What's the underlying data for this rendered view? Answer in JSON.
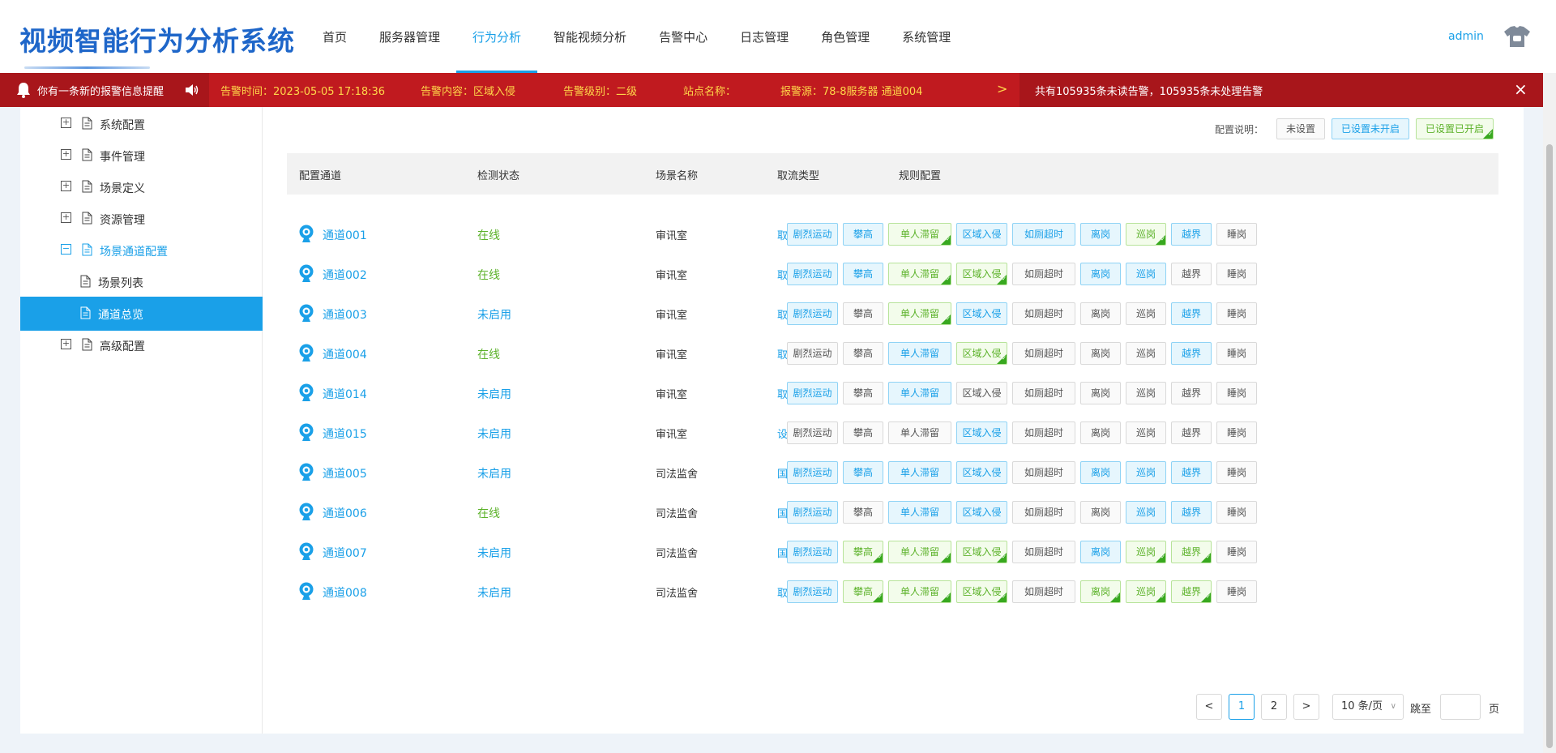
{
  "app": {
    "title": "视频智能行为分析系统"
  },
  "nav": {
    "items": [
      "首页",
      "服务器管理",
      "行为分析",
      "智能视频分析",
      "告警中心",
      "日志管理",
      "角色管理",
      "系统管理"
    ],
    "active_index": 2
  },
  "user": {
    "name": "admin"
  },
  "alarm": {
    "notice": "你有一条新的报警信息提醒",
    "time": "告警时间：2023-05-05 17:18:36",
    "content": "告警内容：区域入侵",
    "level": "告警级别：二级",
    "site": "站点名称：",
    "source": "报警源：78-8服务器 通道004",
    "summary": "共有105935条未读告警，105935条未处理告警",
    "next": ">",
    "close": "×"
  },
  "sidebar": {
    "items": [
      {
        "label": "系统配置",
        "toggle": "+"
      },
      {
        "label": "事件管理",
        "toggle": "+"
      },
      {
        "label": "场景定义",
        "toggle": "+"
      },
      {
        "label": "资源管理",
        "toggle": "+"
      },
      {
        "label": "场景通道配置",
        "toggle": "−"
      },
      {
        "label": "场景列表"
      },
      {
        "label": "通道总览"
      },
      {
        "label": "高级配置",
        "toggle": "+"
      }
    ]
  },
  "legend": {
    "title": "配置说明：",
    "not_set": "未设置",
    "set_off": "已设置未开启",
    "set_on": "已设置已开启"
  },
  "table": {
    "headers": [
      "配置通道",
      "检测状态",
      "场景名称",
      "取流类型",
      "规则配置"
    ],
    "rule_names": [
      "剧烈运动",
      "攀高",
      "单人滞留",
      "区域入侵",
      "如厕超时",
      "离岗",
      "巡岗",
      "越界",
      "睡岗"
    ],
    "rows": [
      {
        "channel": "通道001",
        "status": "在线",
        "scene": "审讯室",
        "stream": "取流配置",
        "rules": [
          "b",
          "b",
          "g",
          "b",
          "b",
          "b",
          "g",
          "b",
          "n"
        ]
      },
      {
        "channel": "通道002",
        "status": "在线",
        "scene": "审讯室",
        "stream": "取流配置",
        "rules": [
          "b",
          "b",
          "g",
          "g",
          "n",
          "b",
          "b",
          "n",
          "n"
        ]
      },
      {
        "channel": "通道003",
        "status": "未启用",
        "scene": "审讯室",
        "stream": "取流配置",
        "rules": [
          "b",
          "n",
          "g",
          "b",
          "n",
          "n",
          "n",
          "b",
          "n"
        ]
      },
      {
        "channel": "通道004",
        "status": "在线",
        "scene": "审讯室",
        "stream": "取流配置",
        "rules": [
          "n",
          "n",
          "b",
          "g",
          "n",
          "n",
          "n",
          "b",
          "n"
        ]
      },
      {
        "channel": "通道014",
        "status": "未启用",
        "scene": "审讯室",
        "stream": "取流配置",
        "rules": [
          "b",
          "n",
          "b",
          "n",
          "n",
          "n",
          "n",
          "n",
          "n"
        ]
      },
      {
        "channel": "通道015",
        "status": "未启用",
        "scene": "审讯室",
        "stream": "设备",
        "rules": [
          "n",
          "n",
          "n",
          "b",
          "n",
          "n",
          "n",
          "n",
          "n"
        ]
      },
      {
        "channel": "通道005",
        "status": "未启用",
        "scene": "司法监舍",
        "stream": "国标",
        "rules": [
          "b",
          "b",
          "b",
          "b",
          "n",
          "b",
          "b",
          "b",
          "n"
        ]
      },
      {
        "channel": "通道006",
        "status": "在线",
        "scene": "司法监舍",
        "stream": "国标",
        "rules": [
          "b",
          "n",
          "b",
          "b",
          "n",
          "n",
          "b",
          "b",
          "n"
        ]
      },
      {
        "channel": "通道007",
        "status": "未启用",
        "scene": "司法监舍",
        "stream": "国标",
        "rules": [
          "b",
          "g",
          "g",
          "g",
          "n",
          "b",
          "g",
          "g",
          "n"
        ]
      },
      {
        "channel": "通道008",
        "status": "未启用",
        "scene": "司法监舍",
        "stream": "取流配置",
        "rules": [
          "b",
          "g",
          "g",
          "g",
          "n",
          "g",
          "g",
          "g",
          "n"
        ]
      }
    ]
  },
  "pagination": {
    "prev": "<",
    "pages": [
      "1",
      "2"
    ],
    "current": "1",
    "next": ">",
    "page_size": "10 条/页",
    "jump_label": "跳至",
    "page_suffix": "页"
  },
  "colors": {
    "brand": "#1e66c9",
    "accent": "#1aa0e8",
    "alarm_bar": "#a8161b",
    "alarm_text": "#ffd84a",
    "online": "#5cb22a"
  }
}
